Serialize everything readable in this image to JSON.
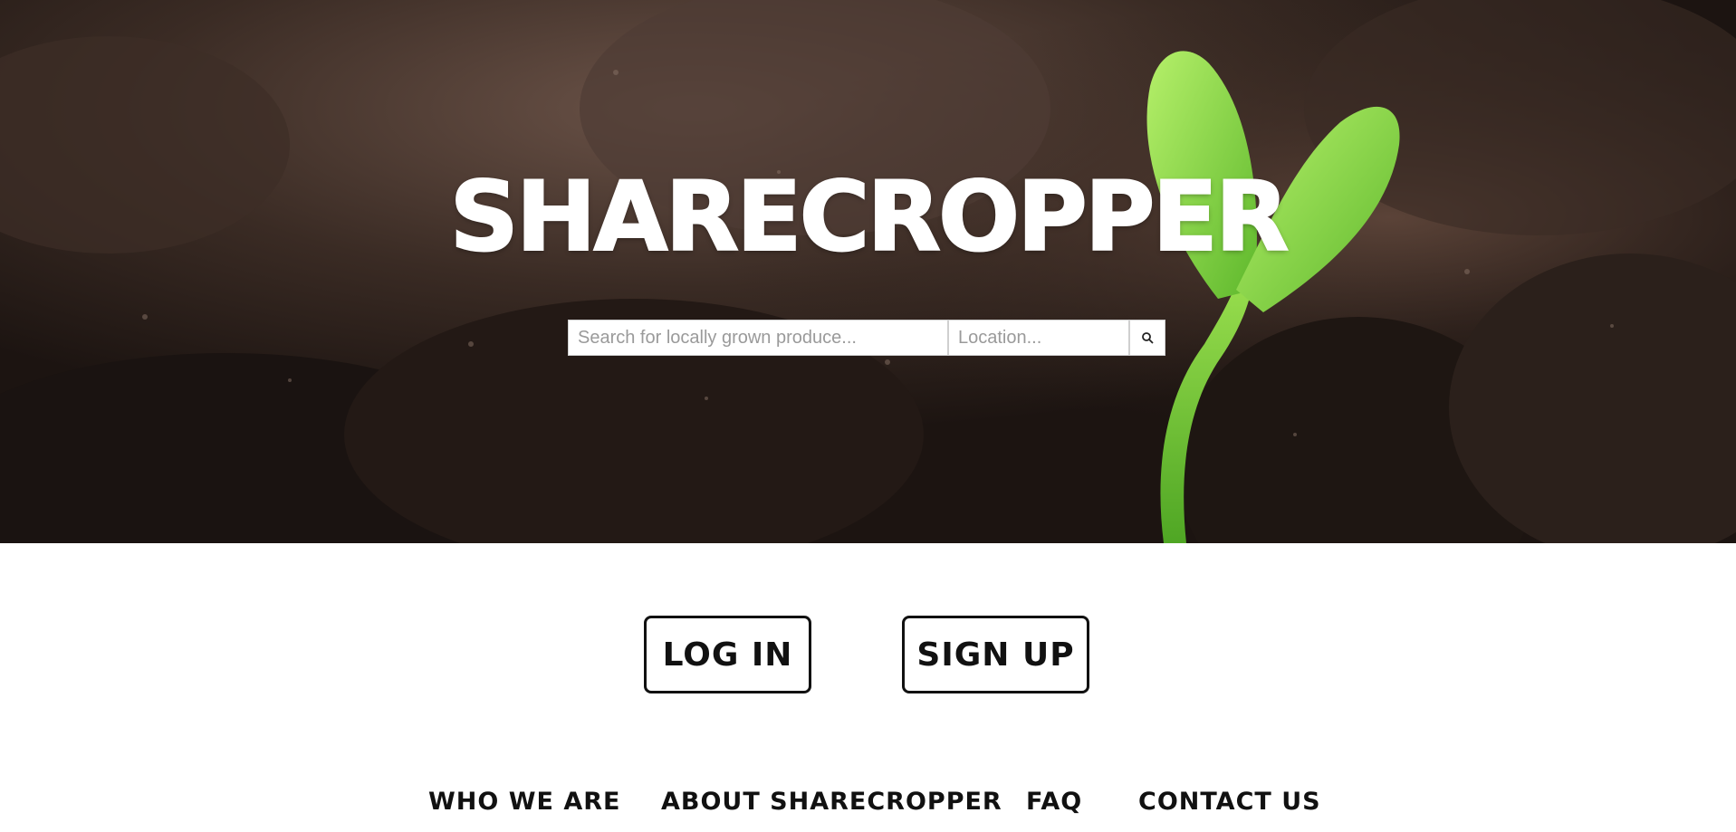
{
  "brand": {
    "title": "SHARECROPPER"
  },
  "search": {
    "query_placeholder": "Search for locally grown produce...",
    "location_placeholder": "Location...",
    "button_icon": "search-icon"
  },
  "auth": {
    "login_label": "LOG IN",
    "signup_label": "SIGN UP"
  },
  "footer_nav": {
    "items": [
      {
        "label": "WHO WE ARE"
      },
      {
        "label": "ABOUT SHARECROPPER"
      },
      {
        "label": "FAQ"
      },
      {
        "label": "CONTACT US"
      }
    ]
  },
  "colors": {
    "soil_dark": "#1f1714",
    "soil_mid": "#4a362c",
    "sprout_green": "#7fd13a",
    "text": "#111111",
    "background": "#ffffff"
  }
}
